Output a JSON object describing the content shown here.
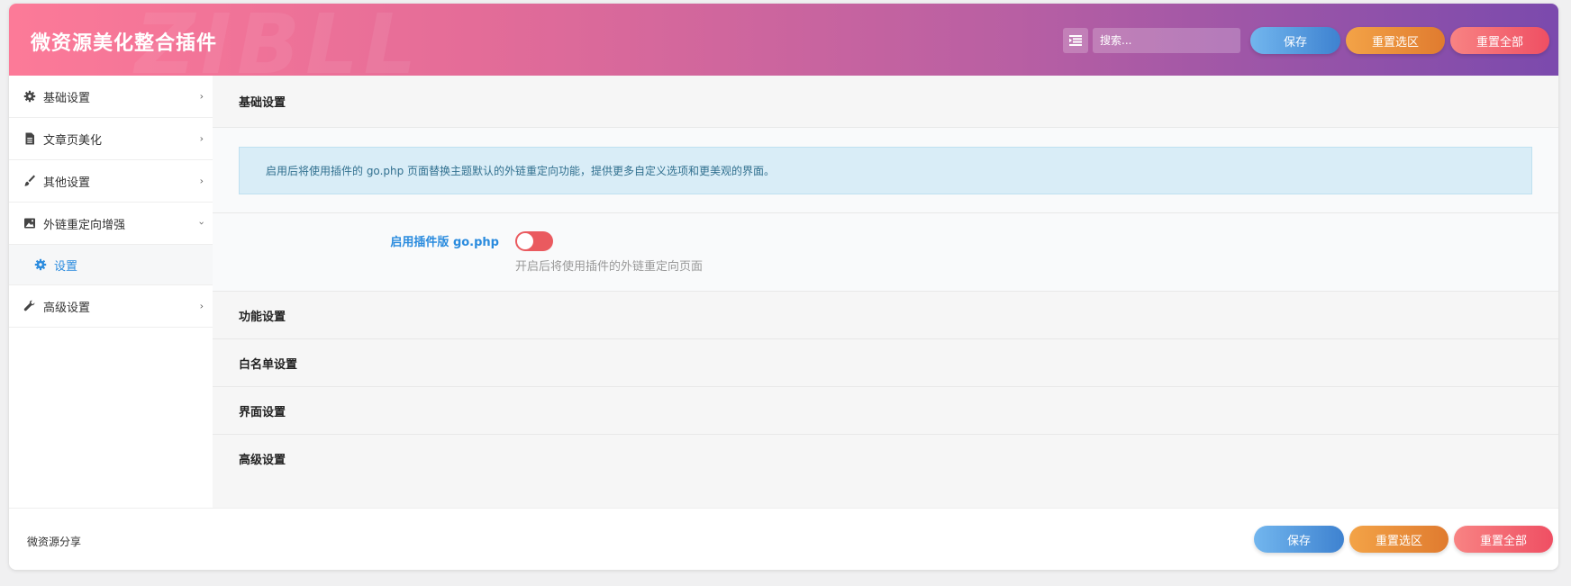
{
  "header": {
    "title": "微资源美化整合插件",
    "watermark": "ZIBLL",
    "search_placeholder": "搜索...",
    "save_label": "保存",
    "reset_section_label": "重置选区",
    "reset_all_label": "重置全部"
  },
  "sidebar": {
    "items": [
      {
        "label": "基础设置",
        "icon": "gear-icon"
      },
      {
        "label": "文章页美化",
        "icon": "document-icon"
      },
      {
        "label": "其他设置",
        "icon": "brush-icon"
      },
      {
        "label": "外链重定向增强",
        "icon": "image-icon",
        "expanded": true
      },
      {
        "label": "高级设置",
        "icon": "wrench-icon"
      }
    ],
    "sub_items": [
      {
        "label": "设置",
        "icon": "gear-icon",
        "active": true
      }
    ]
  },
  "main": {
    "section_title": "基础设置",
    "notice": "启用后将使用插件的 go.php 页面替换主题默认的外链重定向功能，提供更多自定义选项和更美观的界面。",
    "field_label": "启用插件版 go.php",
    "field_help": "开启后将使用插件的外链重定向页面",
    "toggle_on": false,
    "collapsed_sections": [
      "功能设置",
      "白名单设置",
      "界面设置",
      "高级设置"
    ]
  },
  "footer": {
    "text": "微资源分享",
    "save_label": "保存",
    "reset_section_label": "重置选区",
    "reset_all_label": "重置全部"
  },
  "colors": {
    "accent": "#2a8bde",
    "toggle_off": "#ea5a5f",
    "notice_bg": "#d9edf7"
  }
}
